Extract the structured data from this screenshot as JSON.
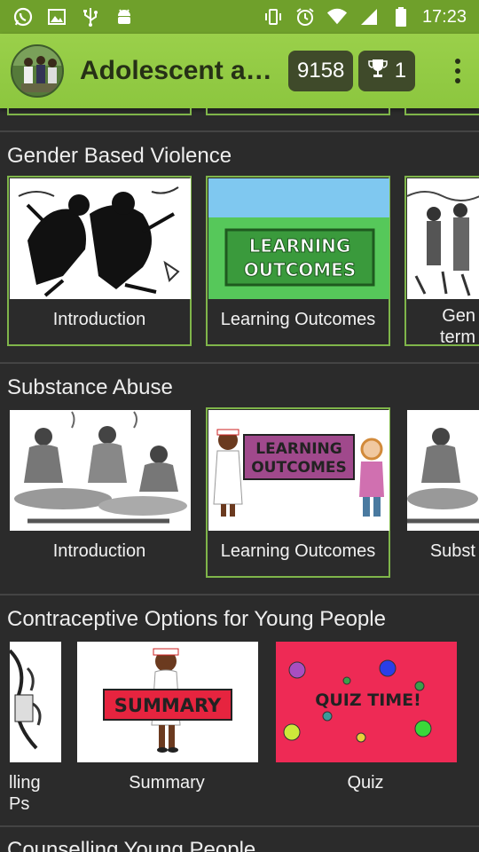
{
  "status_bar": {
    "time": "17:23",
    "left_icons": [
      "whatsapp-icon",
      "image-icon",
      "usb-icon",
      "android-icon"
    ],
    "right_icons": [
      "vibrate-icon",
      "alarm-icon",
      "wifi-icon",
      "signal-icon",
      "battery-icon"
    ]
  },
  "app_bar": {
    "title": "Adolescent an...",
    "score": "9158",
    "trophies": "1"
  },
  "sections": [
    {
      "title": "Gender Based Violence",
      "cards": [
        {
          "label": "Introduction",
          "thumb": "violence-sketch"
        },
        {
          "label": "Learning Outcomes",
          "thumb": "learning-outcomes-sign",
          "thumb_text": [
            "LEARNING",
            "OUTCOMES"
          ]
        },
        {
          "label_lines": [
            "Gen",
            "term"
          ],
          "thumb": "people-sketch"
        }
      ]
    },
    {
      "title": "Substance Abuse",
      "cards": [
        {
          "label": "Introduction",
          "thumb": "smoking-sketch"
        },
        {
          "label": "Learning Outcomes",
          "thumb": "nurses-learning-outcomes",
          "thumb_text": [
            "LEARNING",
            "OUTCOMES"
          ]
        },
        {
          "label": "Subst",
          "thumb": "smoking-sketch"
        }
      ]
    },
    {
      "title": "Contraceptive Options for Young People",
      "cards": [
        {
          "label_lines": [
            "lling",
            "Ps"
          ],
          "thumb": "sketch-partial"
        },
        {
          "label": "Summary",
          "thumb": "nurse-summary",
          "thumb_text": "SUMMARY"
        },
        {
          "label": "Quiz",
          "thumb": "quiz-time",
          "thumb_text": "QUIZ TIME!"
        }
      ]
    },
    {
      "title": "Counselling Young People"
    }
  ],
  "colors": {
    "status_bar": "#6fa02b",
    "app_bar": "#8cc63f",
    "background": "#2b2b2b",
    "selected_border": "#7fb54a"
  }
}
